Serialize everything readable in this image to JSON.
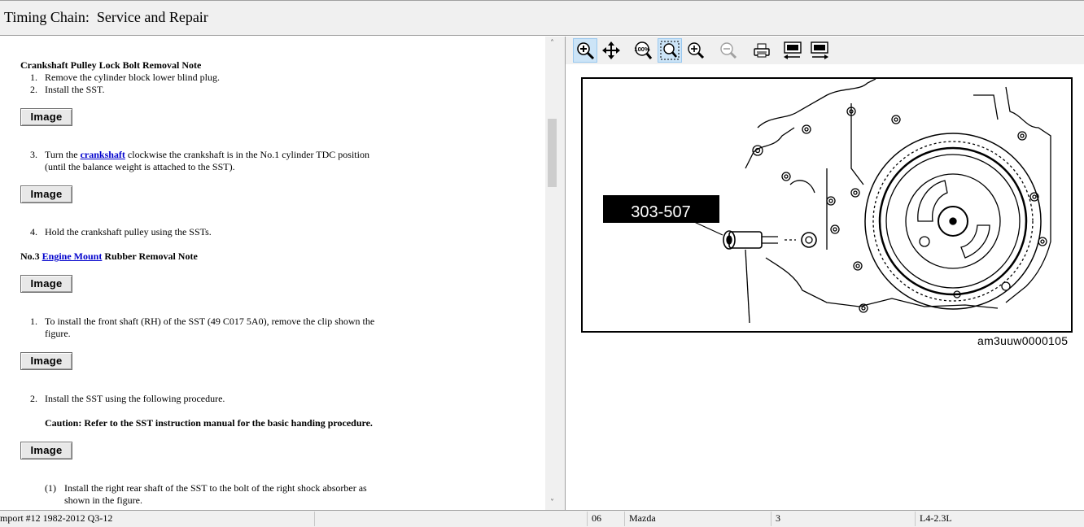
{
  "title_bar": {
    "title": "Timing Chain:  Service and Repair"
  },
  "document": {
    "heading1": "Crankshaft Pulley Lock Bolt Removal Note",
    "steps_a": [
      {
        "num": "1.",
        "text": "Remove the cylinder block lower blind plug."
      },
      {
        "num": "2.",
        "text": "Install the SST."
      }
    ],
    "image_button_label": "Image",
    "step3_num": "3.",
    "step3_pre": "Turn the ",
    "step3_link": "crankshaft",
    "step3_post": " clockwise the crankshaft is in the No.1 cylinder TDC position",
    "step3_line2": "(until the balance weight is attached to the SST).",
    "step4_num": "4.",
    "step4_text": "Hold the crankshaft pulley using the SSTs.",
    "heading2_pre": "No.3 ",
    "heading2_link": "Engine Mount",
    "heading2_post": " Rubber Removal Note",
    "stepb1_num": "1.",
    "stepb1_line1": "To install the front shaft (RH) of the SST (49 C017 5A0), remove the clip shown the",
    "stepb1_line2": "figure.",
    "stepb2_num": "2.",
    "stepb2_text": "Install the SST using the following procedure.",
    "caution": "Caution: Refer to the SST instruction manual for the basic handing procedure.",
    "substep_num": "(1)",
    "substep_line1": "Install the right rear shaft of the SST to the bolt of the right shock absorber as",
    "substep_line2": "shown in the figure."
  },
  "viewer": {
    "toolbar": [
      {
        "name": "zoom-in-tool-icon",
        "active": true
      },
      {
        "name": "pan-tool-icon",
        "active": false
      },
      {
        "name": "actual-size-icon",
        "active": false,
        "text": "100%"
      },
      {
        "name": "zoom-fit-icon",
        "active": true
      },
      {
        "name": "zoom-in-icon",
        "active": false
      },
      {
        "name": "zoom-out-icon",
        "active": false
      },
      {
        "name": "print-icon",
        "active": false
      },
      {
        "name": "previous-image-icon",
        "active": false
      },
      {
        "name": "next-image-icon",
        "active": false
      }
    ],
    "figure_label": "303-507",
    "figure_caption": "am3uuw0000105"
  },
  "status_bar": {
    "import": "mport #12 1982-2012 Q3-12",
    "code": "06",
    "make": "Mazda",
    "page": "3",
    "engine": "L4-2.3L"
  },
  "colors": {
    "link": "#0000cc",
    "chrome": "#f0f0f0",
    "active_tool": "#cce4f7"
  }
}
